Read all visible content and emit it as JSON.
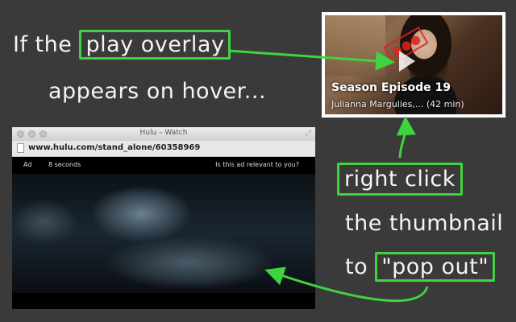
{
  "annotations": {
    "line1_prefix": "If the",
    "line1_highlight": "play overlay",
    "line2": "appears on hover...",
    "step1": "right click",
    "step2": "the thumbnail",
    "step3_prefix": "to",
    "step3_highlight": "\"pop out\""
  },
  "thumbnail": {
    "title": "Season  Episode 19",
    "subtitle": "Julianna Margulies,...  (42 min)"
  },
  "window": {
    "title": "Hulu – Watch",
    "url": "www.hulu.com/stand_alone/60358969",
    "ad_label": "Ad",
    "ad_time": "8 seconds",
    "ad_question": "Is this ad relevant to you?"
  },
  "colors": {
    "highlight": "#3fd43f",
    "background": "#3a3a3a"
  }
}
